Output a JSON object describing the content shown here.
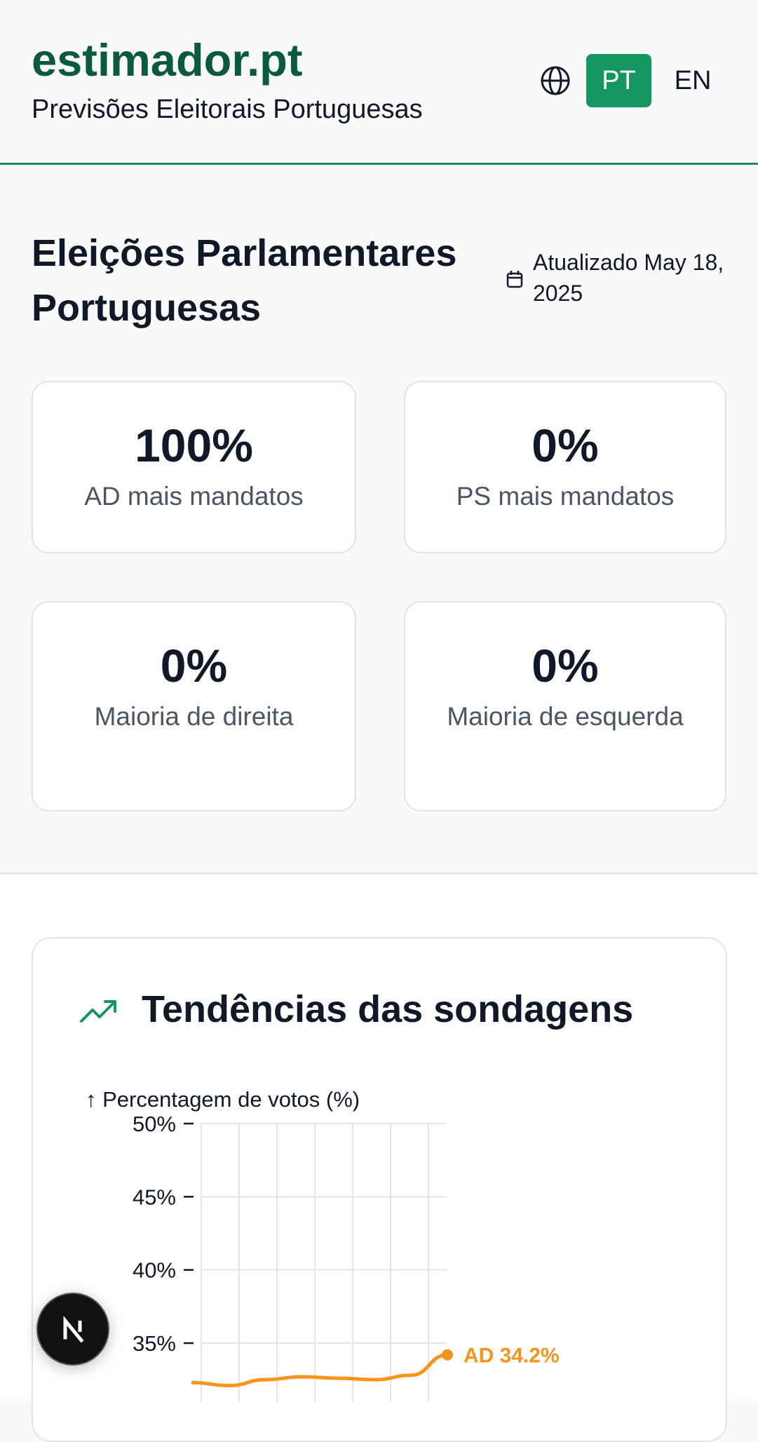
{
  "header": {
    "brand": "estimador.pt",
    "tagline": "Previsões Eleitorais Portuguesas",
    "languages": [
      "PT",
      "EN"
    ],
    "active_language": "PT",
    "accent_color": "#15955f",
    "brand_color": "#0b5a40"
  },
  "overview": {
    "title": "Eleições Parlamentares Portuguesas",
    "updated": "Atualizado May 18, 2025",
    "cards": [
      {
        "value": "100%",
        "label": "AD mais mandatos"
      },
      {
        "value": "0%",
        "label": "PS mais mandatos"
      },
      {
        "value": "0%",
        "label": "Maioria de direita"
      },
      {
        "value": "0%",
        "label": "Maioria de esquerda"
      }
    ]
  },
  "trends": {
    "title": "Tendências das sondagens",
    "icon": "trending-up-icon"
  },
  "chart_data": {
    "type": "line",
    "ylabel": "↑ Percentagem de votos (%)",
    "yticks": [
      "50%",
      "45%",
      "40%",
      "35%"
    ],
    "ytick_values": [
      50,
      45,
      40,
      35
    ],
    "ylim": [
      32,
      50
    ],
    "grid": true,
    "series": [
      {
        "name": "AD",
        "color": "#f7941d",
        "values": [
          32.3,
          32.1,
          32.5,
          32.7,
          32.6,
          32.5,
          32.8,
          34.2
        ],
        "end_label": "AD 34.2%"
      }
    ]
  }
}
